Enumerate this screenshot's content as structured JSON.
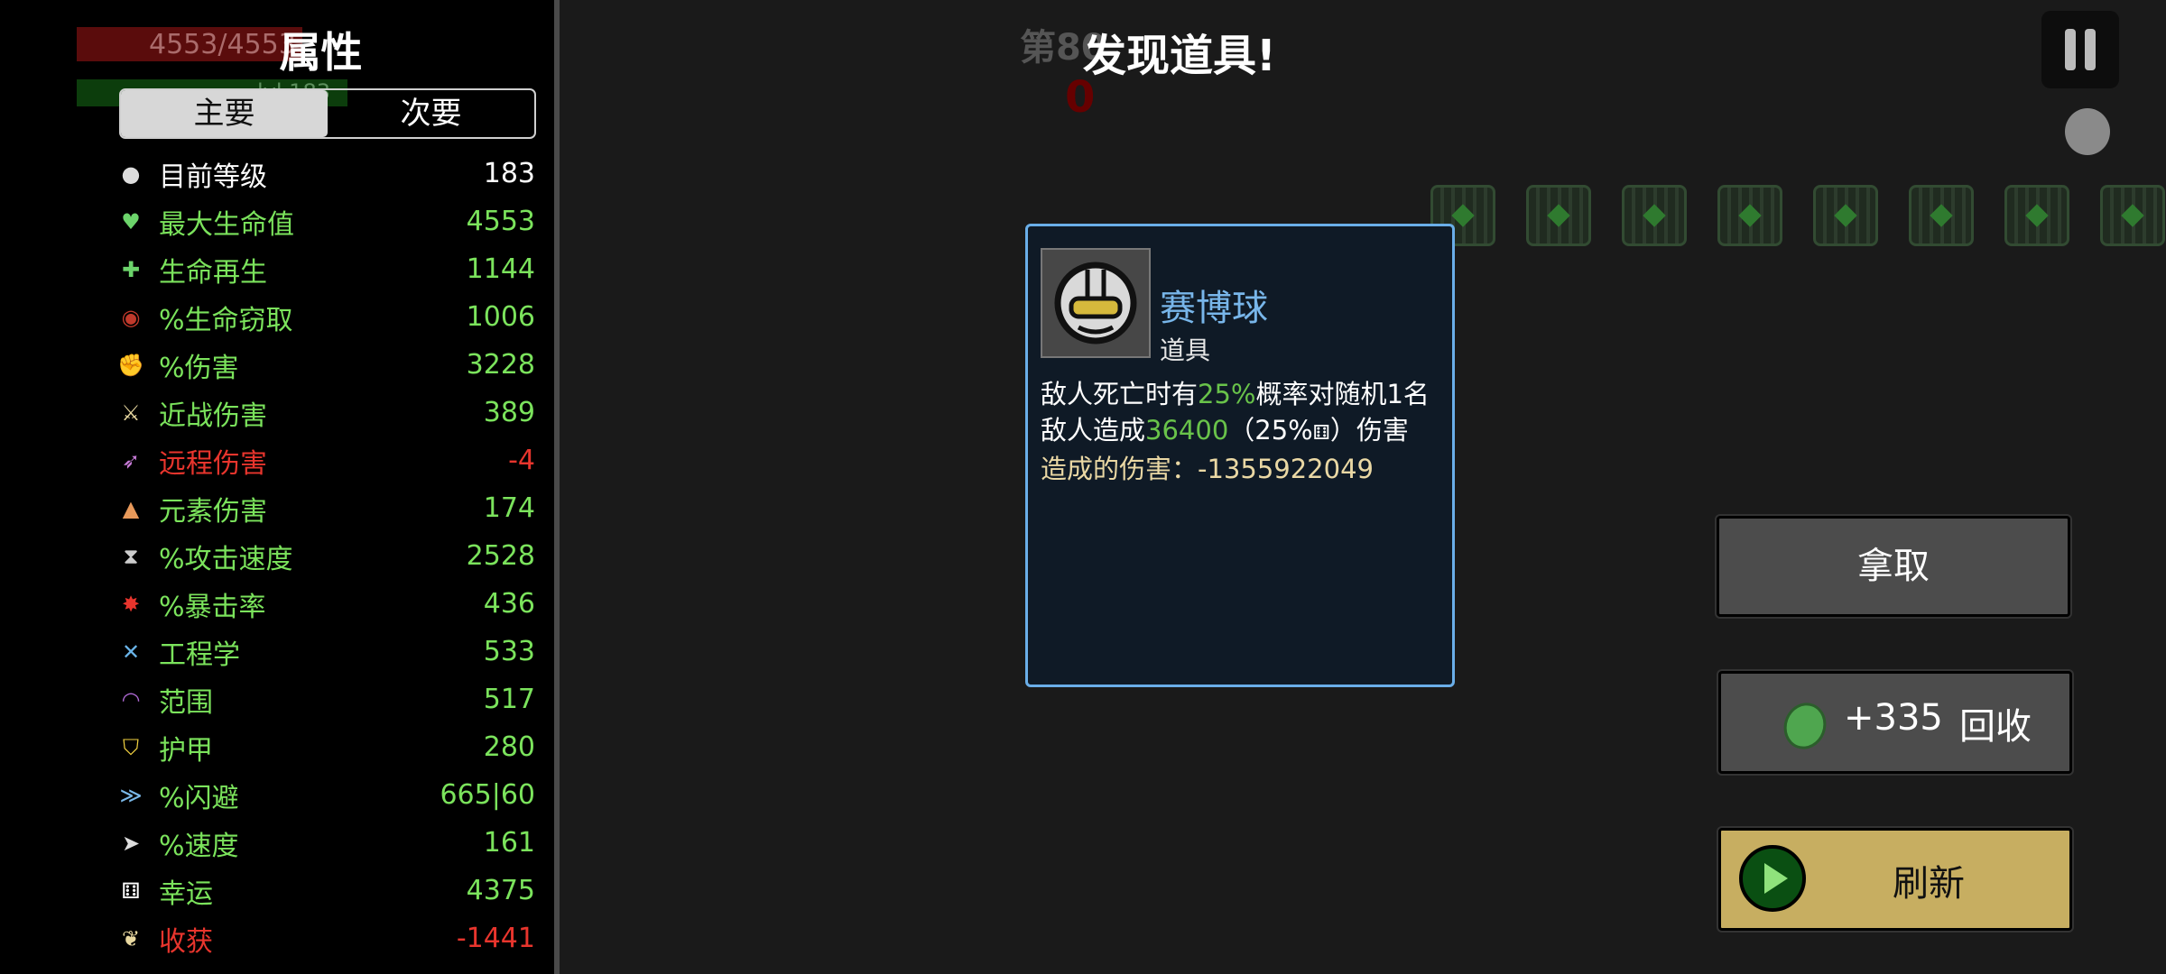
{
  "hud": {
    "hp_text": "4553/4553",
    "xp_text": "lvl 183",
    "wave": "第80",
    "timer": "0"
  },
  "panel": {
    "title": "属性",
    "tabs": [
      {
        "label": "主要",
        "active": true
      },
      {
        "label": "次要",
        "active": false
      }
    ],
    "stats": [
      {
        "icon": "level-icon",
        "glyph": "●",
        "label": "目前等级",
        "value": "183",
        "color": "#ffffff",
        "icon_color": "#dddddd"
      },
      {
        "icon": "heart-icon",
        "glyph": "♥",
        "label": "最大生命值",
        "value": "4553",
        "color": "#7be35c",
        "icon_color": "#6cd46b"
      },
      {
        "icon": "regen-icon",
        "glyph": "✚",
        "label": "生命再生",
        "value": "1144",
        "color": "#7be35c",
        "icon_color": "#6cd46b"
      },
      {
        "icon": "lifesteal-icon",
        "glyph": "◉",
        "label": "%生命窃取",
        "value": "1006",
        "color": "#7be35c",
        "icon_color": "#c0392b"
      },
      {
        "icon": "damage-icon",
        "glyph": "✊",
        "label": "%伤害",
        "value": "3228",
        "color": "#7be35c",
        "icon_color": "#c0392b"
      },
      {
        "icon": "melee-icon",
        "glyph": "⚔",
        "label": "近战伤害",
        "value": "389",
        "color": "#7be35c",
        "icon_color": "#e8d8a0"
      },
      {
        "icon": "ranged-icon",
        "glyph": "➶",
        "label": "远程伤害",
        "value": "-4",
        "color": "#e8352d",
        "icon_color": "#c67ad6"
      },
      {
        "icon": "elemental-icon",
        "glyph": "▲",
        "label": "元素伤害",
        "value": "174",
        "color": "#7be35c",
        "icon_color": "#e8995a"
      },
      {
        "icon": "attack-speed-icon",
        "glyph": "⧗",
        "label": "%攻击速度",
        "value": "2528",
        "color": "#7be35c",
        "icon_color": "#cccccc"
      },
      {
        "icon": "crit-icon",
        "glyph": "✸",
        "label": "%暴击率",
        "value": "436",
        "color": "#7be35c",
        "icon_color": "#e8352d"
      },
      {
        "icon": "engineering-icon",
        "glyph": "✕",
        "label": "工程学",
        "value": "533",
        "color": "#7be35c",
        "icon_color": "#6ab4e8"
      },
      {
        "icon": "range-icon",
        "glyph": "◠",
        "label": "范围",
        "value": "517",
        "color": "#7be35c",
        "icon_color": "#b06ad6"
      },
      {
        "icon": "armor-icon",
        "glyph": "⛉",
        "label": "护甲",
        "value": "280",
        "color": "#7be35c",
        "icon_color": "#f0d040"
      },
      {
        "icon": "dodge-icon",
        "glyph": "≫",
        "label": "%闪避",
        "value": "665|60",
        "color": "#7be35c",
        "icon_color": "#7ab8e8"
      },
      {
        "icon": "speed-icon",
        "glyph": "➤",
        "label": "%速度",
        "value": "161",
        "color": "#7be35c",
        "icon_color": "#dddddd"
      },
      {
        "icon": "luck-icon",
        "glyph": "⚅",
        "label": "幸运",
        "value": "4375",
        "color": "#7be35c",
        "icon_color": "#ffffff"
      },
      {
        "icon": "harvest-icon",
        "glyph": "❦",
        "label": "收获",
        "value": "-1441",
        "color": "#e8352d",
        "icon_color": "#e8d8a0"
      }
    ]
  },
  "popup": {
    "title": "发现道具!",
    "item": {
      "name": "赛博球",
      "type": "道具",
      "desc_part1": "敌人死亡时有",
      "desc_chance": "25%",
      "desc_part2": "概率对随机1名",
      "desc_part3": "敌人造成",
      "desc_damage": "36400",
      "desc_part4": "（25%",
      "desc_part5": "）伤害",
      "damage_dealt": "造成的伤害：-1355922049"
    }
  },
  "actions": {
    "take_label": "拿取",
    "recycle_amount": "+335",
    "recycle_label": "回收",
    "reroll_label": "刷新"
  }
}
